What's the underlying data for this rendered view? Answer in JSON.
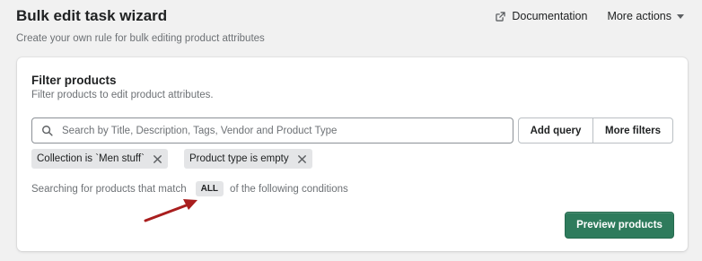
{
  "header": {
    "title": "Bulk edit task wizard",
    "subtitle": "Create your own rule for bulk editing product attributes",
    "documentation_label": "Documentation",
    "more_actions_label": "More actions"
  },
  "filter_card": {
    "title": "Filter products",
    "subtitle": "Filter products to edit product attributes.",
    "search": {
      "placeholder": "Search by Title, Description, Tags, Vendor and Product Type",
      "value": ""
    },
    "add_query_label": "Add query",
    "more_filters_label": "More filters",
    "tags": [
      {
        "label": "Collection is `Men stuff`"
      },
      {
        "label": "Product type is empty"
      }
    ],
    "condition": {
      "prefix": "Searching for products that match",
      "match_mode": "ALL",
      "suffix": "of the following conditions"
    },
    "preview_label": "Preview products"
  },
  "colors": {
    "primary_button": "#2e7b5c",
    "annotation_arrow": "#a91e1e",
    "tag_background": "#e4e5e7"
  },
  "icons": [
    "external-link-icon",
    "caret-down-icon",
    "search-icon",
    "close-icon",
    "annotation-arrow"
  ]
}
